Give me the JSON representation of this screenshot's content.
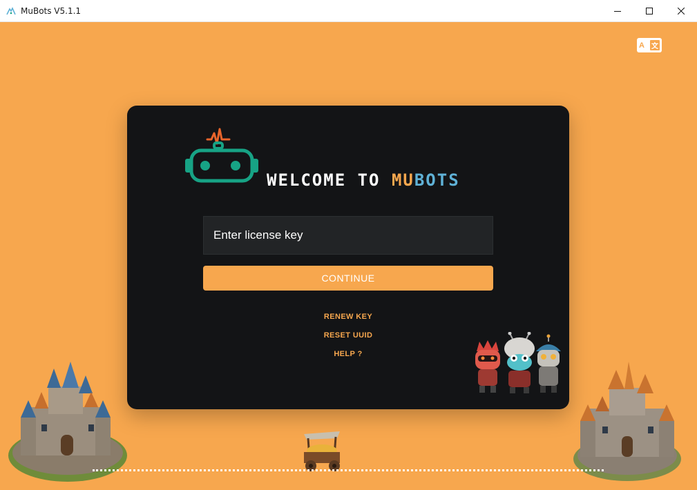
{
  "window": {
    "title": "MuBots V5.1.1",
    "controls": {
      "minimize_icon": "minimize-icon",
      "maximize_icon": "maximize-icon",
      "close_icon": "close-icon"
    }
  },
  "language_toggle": {
    "left_letter": "A",
    "right_letter": "文"
  },
  "welcome": {
    "prefix": "WELCOME TO ",
    "brand_part1": "MU",
    "brand_part2": "BOTS"
  },
  "license": {
    "placeholder": "Enter license key",
    "value": ""
  },
  "continue_label": "CONTINUE",
  "links": {
    "renew_key": "RENEW KEY",
    "reset_uuid": "RESET UUID",
    "help": "HELP ?"
  },
  "colors": {
    "background": "#f7a74e",
    "card": "#131416",
    "accent_orange": "#f7a74e",
    "accent_blue": "#5fb1d6",
    "robot_teal": "#17a385",
    "pulse_orange": "#e8642b",
    "input_bg": "#222426"
  }
}
